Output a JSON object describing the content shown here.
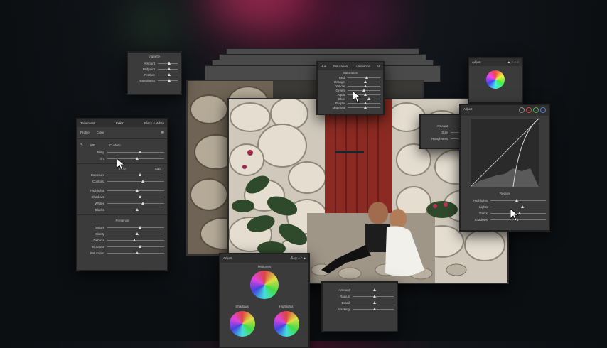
{
  "left_panel": {
    "tabs": [
      "Treatment",
      "Color",
      "Black & White"
    ],
    "profile_label": "Profile",
    "profile_value": "Color",
    "wb_label": "WB",
    "wb_value": "Custom",
    "wb_sliders": [
      {
        "label": "Temp",
        "pos": 0.55
      },
      {
        "label": "Tint",
        "pos": 0.5
      }
    ],
    "tone_label": "Tone",
    "auto_label": "Auto",
    "tone_sliders": [
      {
        "label": "Exposure",
        "pos": 0.55
      },
      {
        "label": "Contrast",
        "pos": 0.6
      }
    ],
    "tone_sliders2": [
      {
        "label": "Highlights",
        "pos": 0.5
      },
      {
        "label": "Shadows",
        "pos": 0.55
      },
      {
        "label": "Whites",
        "pos": 0.6
      },
      {
        "label": "Blacks",
        "pos": 0.5
      }
    ],
    "presence_label": "Presence",
    "presence_sliders": [
      {
        "label": "Texture",
        "pos": 0.55
      },
      {
        "label": "Clarity",
        "pos": 0.5
      },
      {
        "label": "Dehaze",
        "pos": 0.45
      },
      {
        "label": "Vibrance",
        "pos": 0.55
      },
      {
        "label": "Saturation",
        "pos": 0.5
      }
    ]
  },
  "hsl_panel": {
    "tabs": [
      "Hue",
      "Saturation",
      "Luminance",
      "All"
    ],
    "section": "Saturation",
    "sliders": [
      {
        "label": "Red",
        "pos": 0.55
      },
      {
        "label": "Orange",
        "pos": 0.5
      },
      {
        "label": "Yellow",
        "pos": 0.5
      },
      {
        "label": "Green",
        "pos": 0.45
      },
      {
        "label": "Aqua",
        "pos": 0.5
      },
      {
        "label": "Blue",
        "pos": 0.6
      },
      {
        "label": "Purple",
        "pos": 0.5
      },
      {
        "label": "Magenta",
        "pos": 0.5
      }
    ]
  },
  "grain_panel": {
    "section": "Grain",
    "sliders": [
      {
        "label": "Amount",
        "pos": 0.4
      },
      {
        "label": "Size",
        "pos": 0.55
      },
      {
        "label": "Roughness",
        "pos": 0.5
      }
    ]
  },
  "curve_panel": {
    "title": "Adjust",
    "region_label": "Region",
    "sliders": [
      {
        "label": "Highlights",
        "pos": 0.45
      },
      {
        "label": "Lights",
        "pos": 0.55
      },
      {
        "label": "Darks",
        "pos": 0.5
      },
      {
        "label": "Shadows",
        "pos": 0.45
      }
    ],
    "dots": [
      "#8a8a8a",
      "#d94444",
      "#4caf50",
      "#4a7fd8"
    ]
  },
  "grading_panel": {
    "title": "Adjust",
    "midtones": "Midtones",
    "shadows": "Shadows",
    "highlights": "Highlights"
  },
  "small_top_panel": {
    "section": "Vignette",
    "sliders": [
      {
        "label": "Amount",
        "pos": 0.5
      },
      {
        "label": "Midpoint",
        "pos": 0.5
      },
      {
        "label": "Feather",
        "pos": 0.5
      },
      {
        "label": "Roundness",
        "pos": 0.5
      }
    ]
  },
  "color_wheel_small": {
    "title": "Adjust"
  },
  "bottom_panel": {
    "sliders": [
      {
        "label": "Amount",
        "pos": 0.5
      },
      {
        "label": "Radius",
        "pos": 0.5
      },
      {
        "label": "Detail",
        "pos": 0.5
      },
      {
        "label": "Masking",
        "pos": 0.5
      }
    ]
  }
}
